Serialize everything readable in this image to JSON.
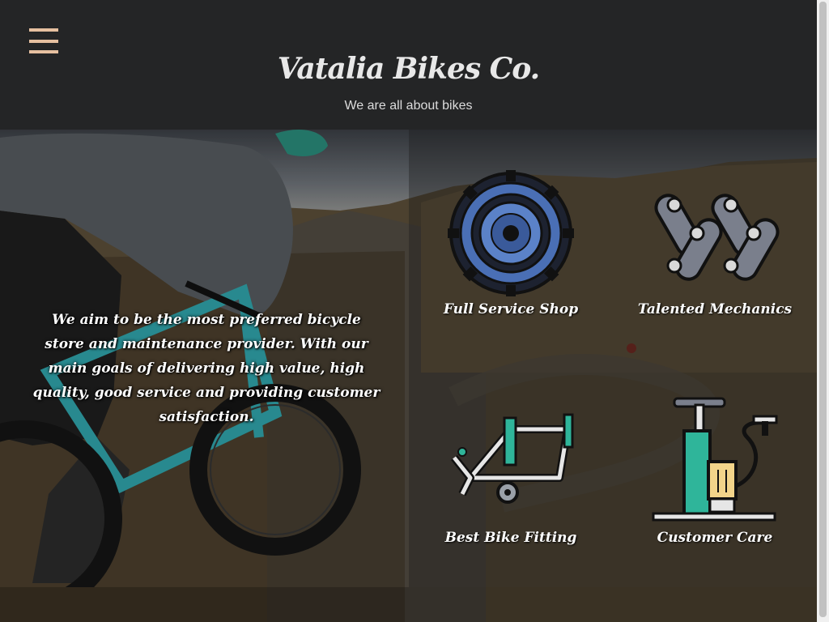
{
  "header": {
    "menu_icon": "hamburger-menu-icon",
    "title": "Vatalia Bikes Co.",
    "tagline": "We are all about bikes"
  },
  "hero": {
    "mission": "We aim to be the most preferred bicycle store and maintenance provider. With our main goals of delivering high value, high quality, good service and providing customer satisfaction."
  },
  "services": [
    {
      "label": "Full Service Shop",
      "icon": "gear-cassette-icon"
    },
    {
      "label": "Talented Mechanics",
      "icon": "bike-chain-icon"
    },
    {
      "label": "Best Bike Fitting",
      "icon": "bike-frame-icon"
    },
    {
      "label": "Customer Care",
      "icon": "bike-pump-icon"
    }
  ],
  "colors": {
    "header_bg": "#242526",
    "menu_accent": "#e6c0a0",
    "title_text": "#e8e8e8",
    "gear_blue": "#4a6fb5",
    "chain_gray": "#7a7f8c",
    "teal": "#2fb59a"
  }
}
